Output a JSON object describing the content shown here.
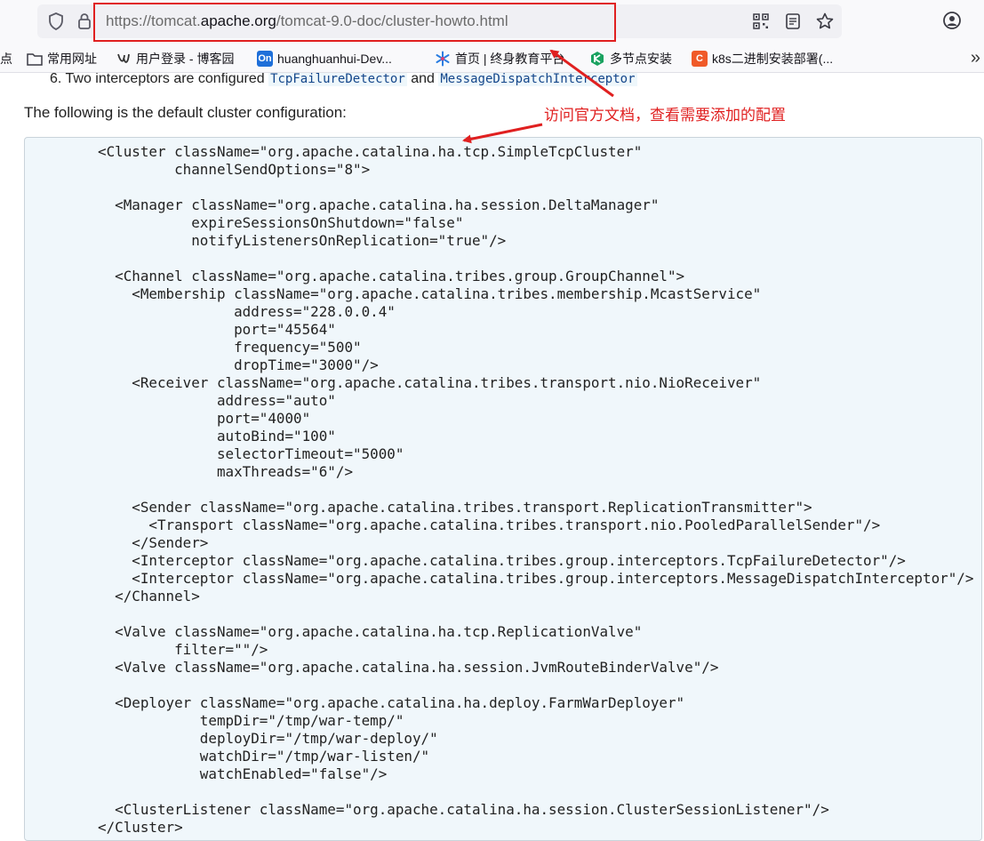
{
  "browser": {
    "url_prefix": "https://tomcat.",
    "url_domain": "apache.org",
    "url_suffix": "/tomcat-9.0-doc/cluster-howto.html"
  },
  "bookmarks": {
    "items": [
      {
        "label": "点"
      },
      {
        "label": "常用网址"
      },
      {
        "label": "用户登录 - 博客园"
      },
      {
        "label": "huanghuanhui-Dev...",
        "badge": "On"
      },
      {
        "label": "首页 | 终身教育平台"
      },
      {
        "label": "多节点安装"
      },
      {
        "label": "k8s二进制安装部署(...",
        "badge": "C"
      }
    ],
    "more_label": "»"
  },
  "page": {
    "prev_item_prefix": "6. Two interceptors are configured ",
    "prev_item_code1": "TcpFailureDetector",
    "prev_item_and": " and ",
    "prev_item_code2": "MessageDispatchInterceptor",
    "intro": "The following is the default cluster configuration:",
    "annotation": "访问官方文档，查看需要添加的配置",
    "code": "<Cluster className=\"org.apache.catalina.ha.tcp.SimpleTcpCluster\"\n         channelSendOptions=\"8\">\n\n  <Manager className=\"org.apache.catalina.ha.session.DeltaManager\"\n           expireSessionsOnShutdown=\"false\"\n           notifyListenersOnReplication=\"true\"/>\n\n  <Channel className=\"org.apache.catalina.tribes.group.GroupChannel\">\n    <Membership className=\"org.apache.catalina.tribes.membership.McastService\"\n                address=\"228.0.0.4\"\n                port=\"45564\"\n                frequency=\"500\"\n                dropTime=\"3000\"/>\n    <Receiver className=\"org.apache.catalina.tribes.transport.nio.NioReceiver\"\n              address=\"auto\"\n              port=\"4000\"\n              autoBind=\"100\"\n              selectorTimeout=\"5000\"\n              maxThreads=\"6\"/>\n\n    <Sender className=\"org.apache.catalina.tribes.transport.ReplicationTransmitter\">\n      <Transport className=\"org.apache.catalina.tribes.transport.nio.PooledParallelSender\"/>\n    </Sender>\n    <Interceptor className=\"org.apache.catalina.tribes.group.interceptors.TcpFailureDetector\"/>\n    <Interceptor className=\"org.apache.catalina.tribes.group.interceptors.MessageDispatchInterceptor\"/>\n  </Channel>\n\n  <Valve className=\"org.apache.catalina.ha.tcp.ReplicationValve\"\n         filter=\"\"/>\n  <Valve className=\"org.apache.catalina.ha.session.JvmRouteBinderValve\"/>\n\n  <Deployer className=\"org.apache.catalina.ha.deploy.FarmWarDeployer\"\n            tempDir=\"/tmp/war-temp/\"\n            deployDir=\"/tmp/war-deploy/\"\n            watchDir=\"/tmp/war-listen/\"\n            watchEnabled=\"false\"/>\n\n  <ClusterListener className=\"org.apache.catalina.ha.session.ClusterSessionListener\"/>\n</Cluster>"
  },
  "colors": {
    "annotation_red": "#e02020",
    "code_bg": "#f0f7fb"
  }
}
